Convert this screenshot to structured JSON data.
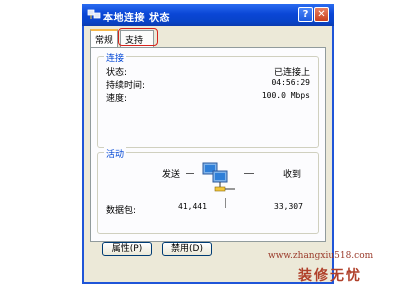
{
  "window": {
    "title": "本地连接 状态",
    "help_glyph": "?",
    "close_glyph": "✕"
  },
  "tabs": [
    {
      "label": "常规"
    },
    {
      "label": "支持"
    }
  ],
  "connection": {
    "group_title": "连接",
    "rows": [
      {
        "label": "状态:",
        "value": "已连接上"
      },
      {
        "label": "持续时间:",
        "value": "04:56:29"
      },
      {
        "label": "速度:",
        "value": "100.0 Mbps"
      }
    ]
  },
  "activity": {
    "group_title": "活动",
    "sent_label": "发送",
    "received_label": "收到",
    "packets_label": "数据包:",
    "packets_sent": "41,441",
    "packets_received": "33,307"
  },
  "buttons": {
    "properties": "属性(P)",
    "disable": "禁用(D)"
  },
  "watermark": {
    "url": "www.zhangxiu518.com",
    "text": "装修无忧"
  },
  "colors": {
    "titlebar": "#0a46d6",
    "group_title": "#0046d5",
    "highlight": "#d6231c"
  }
}
